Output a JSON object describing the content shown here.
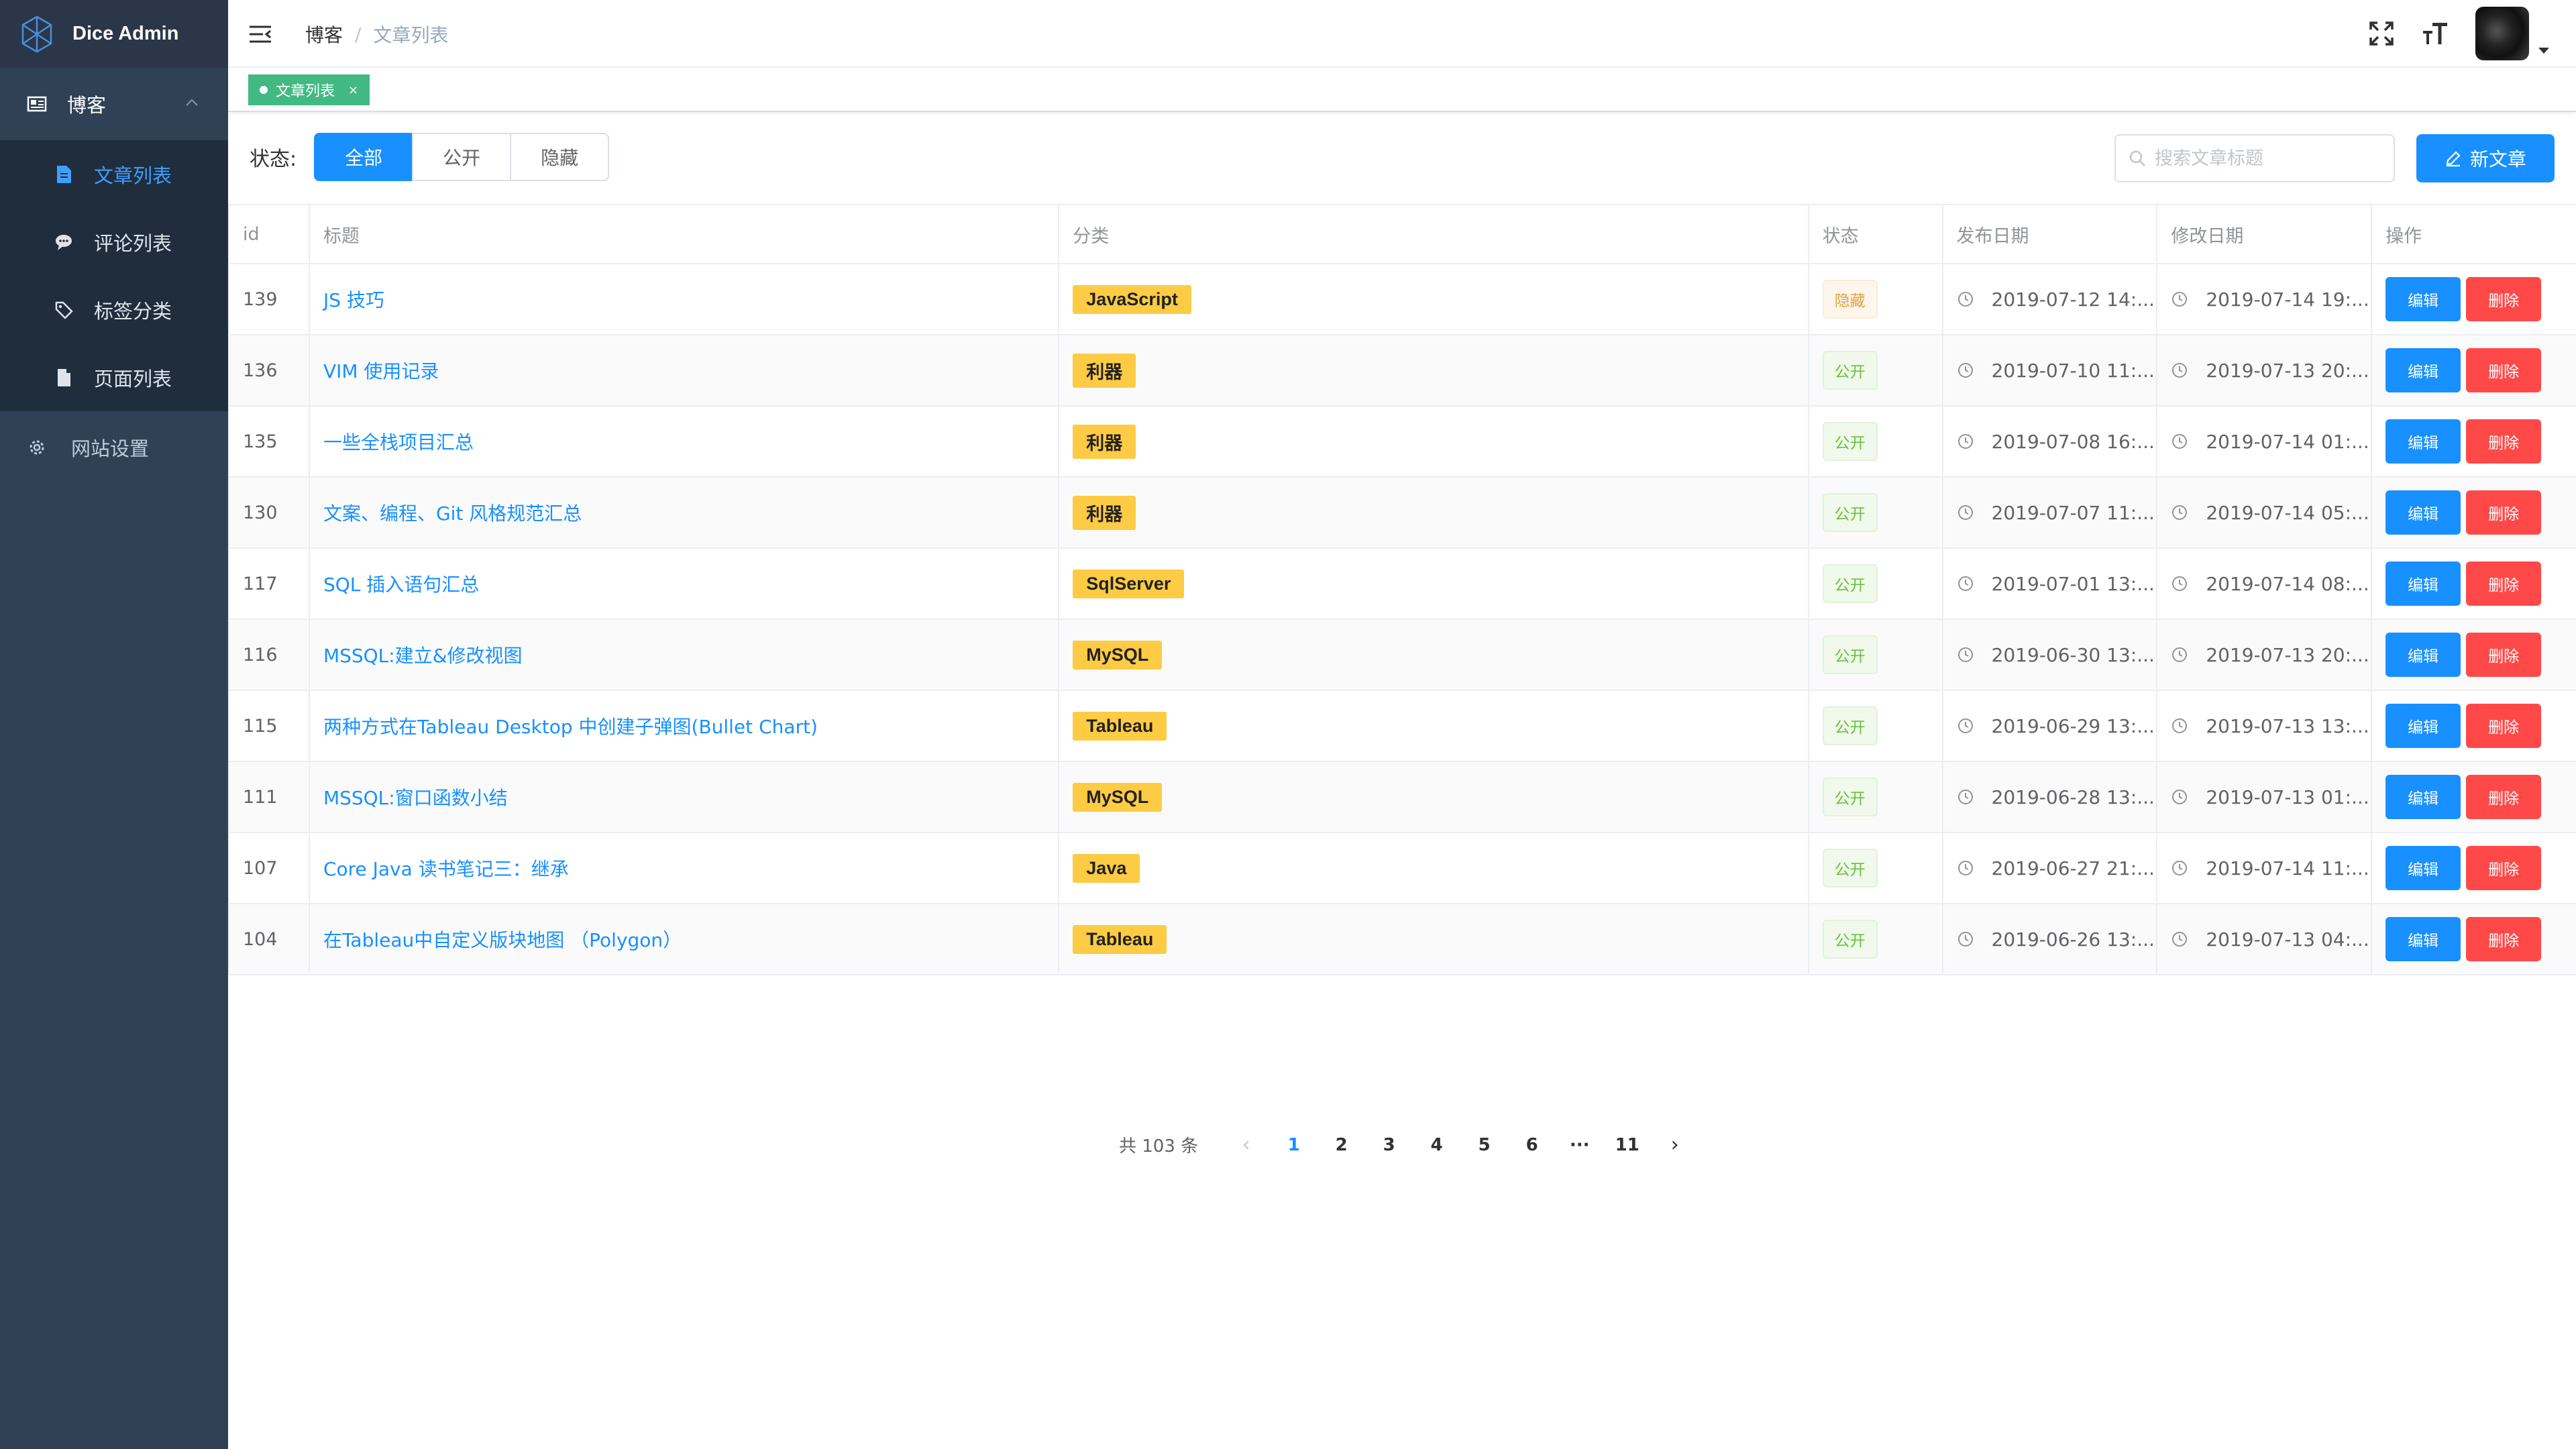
{
  "app": {
    "name": "Dice Admin"
  },
  "sidebar": {
    "group": {
      "label": "博客",
      "icon": "blog-icon"
    },
    "items": [
      {
        "label": "文章列表",
        "icon": "document-icon",
        "active": true
      },
      {
        "label": "评论列表",
        "icon": "comment-icon",
        "active": false
      },
      {
        "label": "标签分类",
        "icon": "tag-icon",
        "active": false
      },
      {
        "label": "页面列表",
        "icon": "page-icon",
        "active": false
      }
    ],
    "settings": {
      "label": "网站设置",
      "icon": "gear-icon"
    }
  },
  "header": {
    "breadcrumb": {
      "home": "博客",
      "separator": "/",
      "current": "文章列表"
    }
  },
  "tagsview": {
    "active_tag": "文章列表",
    "close": "×"
  },
  "filter": {
    "label": "状态:",
    "options": [
      "全部",
      "公开",
      "隐藏"
    ],
    "selected": "全部"
  },
  "search": {
    "placeholder": "搜索文章标题"
  },
  "new_button": {
    "label": "新文章"
  },
  "table": {
    "columns": [
      "id",
      "标题",
      "分类",
      "状态",
      "发布日期",
      "修改日期",
      "操作"
    ],
    "edit_label": "编辑",
    "delete_label": "删除",
    "rows": [
      {
        "id": "139",
        "title": "JS 技巧",
        "category": "JavaScript",
        "status": "隐藏",
        "published": "2019-07-12 14:...",
        "modified": "2019-07-14 19:..."
      },
      {
        "id": "136",
        "title": "VIM 使用记录",
        "category": "利器",
        "status": "公开",
        "published": "2019-07-10 11:...",
        "modified": "2019-07-13 20:..."
      },
      {
        "id": "135",
        "title": "一些全栈项目汇总",
        "category": "利器",
        "status": "公开",
        "published": "2019-07-08 16:...",
        "modified": "2019-07-14 01:..."
      },
      {
        "id": "130",
        "title": "文案、编程、Git 风格规范汇总",
        "category": "利器",
        "status": "公开",
        "published": "2019-07-07 11:...",
        "modified": "2019-07-14 05:..."
      },
      {
        "id": "117",
        "title": "SQL 插入语句汇总",
        "category": "SqlServer",
        "status": "公开",
        "published": "2019-07-01 13:...",
        "modified": "2019-07-14 08:..."
      },
      {
        "id": "116",
        "title": "MSSQL:建立&修改视图",
        "category": "MySQL",
        "status": "公开",
        "published": "2019-06-30 13:...",
        "modified": "2019-07-13 20:..."
      },
      {
        "id": "115",
        "title": "两种方式在Tableau Desktop 中创建子弹图(Bullet Chart)",
        "category": "Tableau",
        "status": "公开",
        "published": "2019-06-29 13:...",
        "modified": "2019-07-13 13:..."
      },
      {
        "id": "111",
        "title": "MSSQL:窗口函数小结",
        "category": "MySQL",
        "status": "公开",
        "published": "2019-06-28 13:...",
        "modified": "2019-07-13 01:..."
      },
      {
        "id": "107",
        "title": "Core Java 读书笔记三：继承",
        "category": "Java",
        "status": "公开",
        "published": "2019-06-27 21:...",
        "modified": "2019-07-14 11:..."
      },
      {
        "id": "104",
        "title": "在Tableau中自定义版块地图 （Polygon）",
        "category": "Tableau",
        "status": "公开",
        "published": "2019-06-26 13:...",
        "modified": "2019-07-13 04:..."
      }
    ]
  },
  "pagination": {
    "total": "共 103 条",
    "pages": [
      "1",
      "2",
      "3",
      "4",
      "5",
      "6",
      "···",
      "11"
    ],
    "current": "1",
    "prev": "‹",
    "next": "›"
  },
  "colors": {
    "sidebar_bg": "#304156",
    "submenu_bg": "#1f2d3d",
    "primary": "#1890ff",
    "danger": "#ff4949",
    "tag_green": "#42b983",
    "category_yellow": "#fdcb44"
  }
}
